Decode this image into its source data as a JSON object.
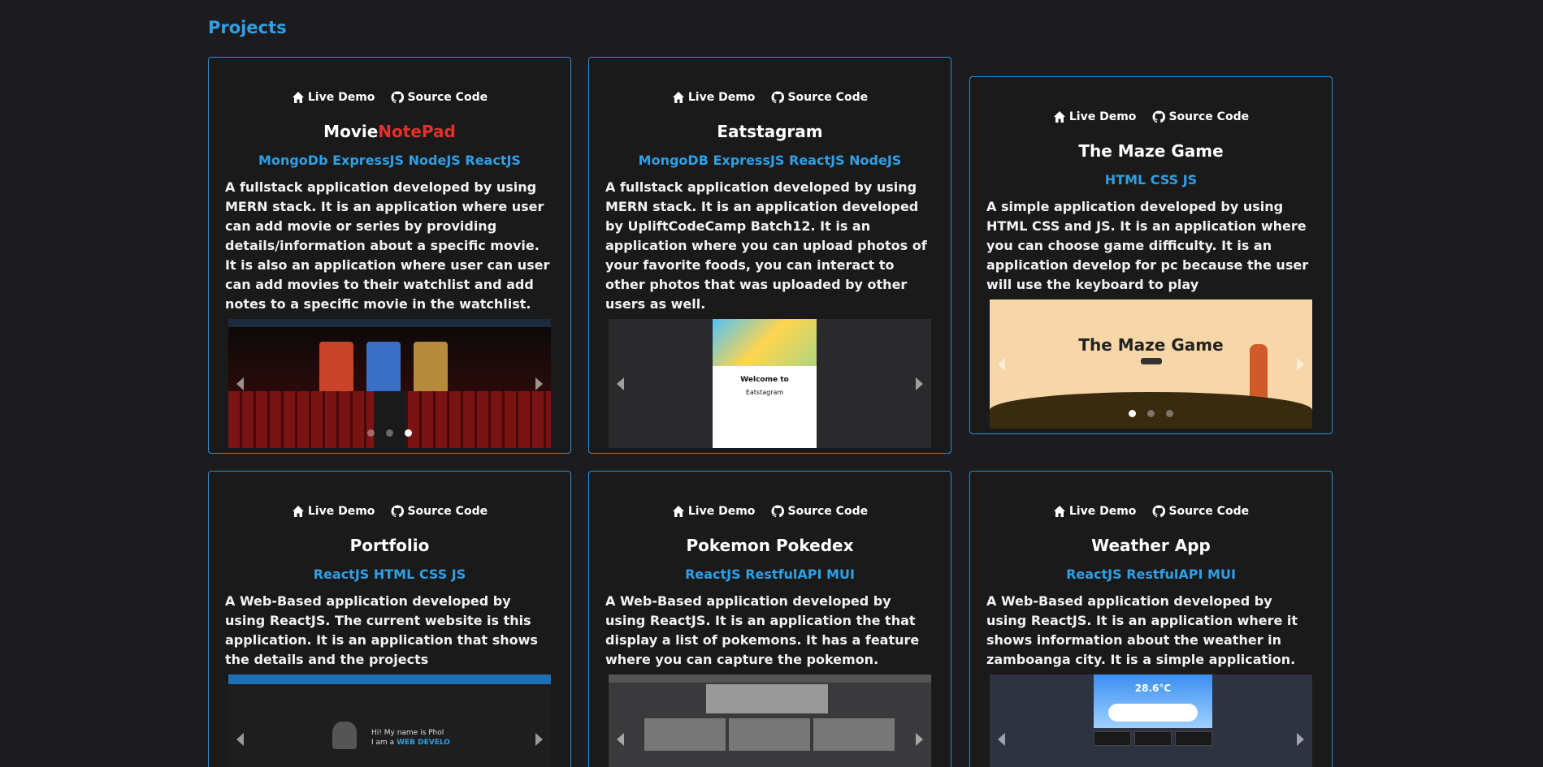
{
  "section": {
    "title": "Projects"
  },
  "common": {
    "live_demo": "Live Demo",
    "source_code": "Source Code"
  },
  "projects": [
    {
      "title_main": "Movie",
      "title_accent": "NotePad",
      "tags": "MongoDb ExpressJS NodeJS ReactJS",
      "description": "A fullstack application developed by using MERN stack. It is an application where user can add movie or series by providing details/information about a specific movie. It is also an application where user can user can add movies to their watchlist and add notes to a specific movie in the watchlist.",
      "accent_color": "#e3312d"
    },
    {
      "title_main": "Eatstagram",
      "title_accent": "",
      "tags": "MongoDB ExpressJS ReactJS NodeJS",
      "description": "A fullstack application developed by using MERN stack. It is an application developed by UpliftCodeCamp Batch12. It is an application where you can upload photos of your favorite foods, you can interact to other photos that was uploaded by other users as well.",
      "slide": {
        "welcome": "Welcome to",
        "logo": "Eatstagram"
      }
    },
    {
      "title_main": "The Maze Game",
      "title_accent": "",
      "tags": "HTML CSS JS",
      "description": "A simple application developed by using HTML CSS and JS. It is an application where you can choose game difficulty. It is an application develop for pc because the user will use the keyboard to play",
      "slide": {
        "heading": "The Maze Game"
      }
    },
    {
      "title_main": "Portfolio",
      "title_accent": "",
      "tags": "ReactJS HTML CSS JS",
      "description": "A Web-Based application developed by using ReactJS. The current website is this application. It is an application that shows the details and the projects",
      "slide": {
        "greeting": "Hi! My name is Phol",
        "role_prefix": "I am a",
        "role": "WEB DEVELO"
      }
    },
    {
      "title_main": "Pokemon Pokedex",
      "title_accent": "",
      "tags": "ReactJS RestfulAPI MUI",
      "description": "A Web-Based application developed by using ReactJS. It is an application the that display a list of pokemons. It has a feature where you can capture the pokemon."
    },
    {
      "title_main": "Weather App",
      "title_accent": "",
      "tags": "ReactJS RestfulAPI MUI",
      "description": "A Web-Based application developed by using ReactJS. It is an application where it shows information about the weather in zamboanga city. It is a simple application.",
      "slide": {
        "temp": "28.6°C"
      }
    }
  ],
  "colors": {
    "background": "#1c1c1e",
    "accent_blue": "#2f9fe6",
    "border": "#2b8fd6"
  }
}
